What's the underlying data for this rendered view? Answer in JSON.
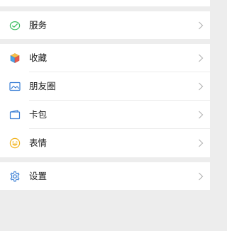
{
  "menu": {
    "service": {
      "label": "服务",
      "icon": "service-icon",
      "color": "#3fbf63"
    },
    "favorites": {
      "label": "收藏",
      "icon": "favorites-cube-icon",
      "color": "#f0a53c"
    },
    "moments": {
      "label": "朋友圈",
      "icon": "moments-image-icon",
      "color": "#3a7fd5"
    },
    "cards": {
      "label": "卡包",
      "icon": "card-wallet-icon",
      "color": "#3a7fd5"
    },
    "stickers": {
      "label": "表情",
      "icon": "sticker-smile-icon",
      "color": "#f2b31d"
    },
    "settings": {
      "label": "设置",
      "icon": "gear-icon",
      "color": "#3a7fd5"
    }
  },
  "chevron_color": "#b6b6b6",
  "background_color": "#ededed"
}
